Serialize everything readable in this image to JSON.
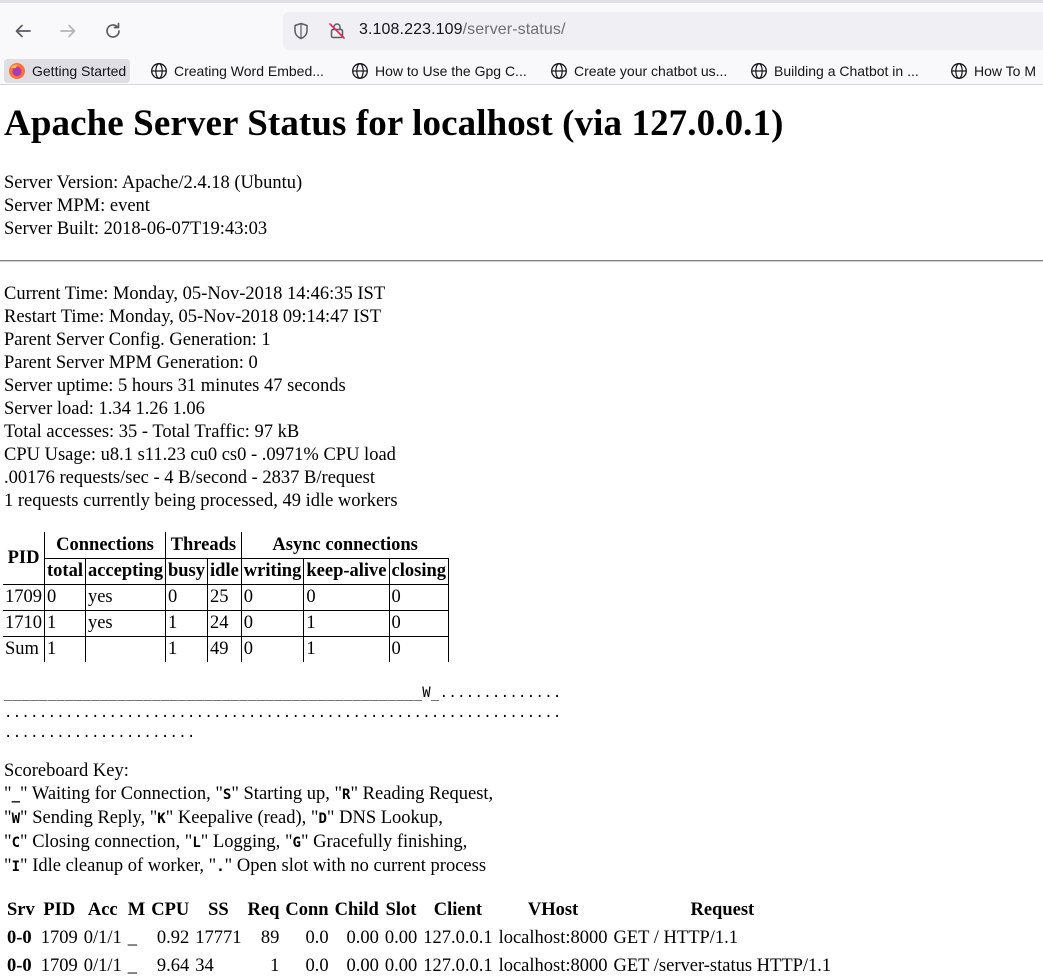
{
  "browser": {
    "url_host": "3.108.223.109",
    "url_path": "/server-status/",
    "bookmarks": [
      {
        "label": "Getting Started"
      },
      {
        "label": "Creating Word Embed..."
      },
      {
        "label": "How to Use the Gpg C..."
      },
      {
        "label": "Create your chatbot us..."
      },
      {
        "label": "Building a Chatbot in ..."
      },
      {
        "label": "How To M"
      }
    ]
  },
  "page": {
    "title": "Apache Server Status for localhost (via 127.0.0.1)",
    "server_info": [
      "Server Version: Apache/2.4.18 (Ubuntu)",
      "Server MPM: event",
      "Server Built: 2018-06-07T19:43:03"
    ],
    "status_info": [
      "Current Time: Monday, 05-Nov-2018 14:46:35 IST",
      "Restart Time: Monday, 05-Nov-2018 09:14:47 IST",
      "Parent Server Config. Generation: 1",
      "Parent Server MPM Generation: 0",
      "Server uptime: 5 hours 31 minutes 47 seconds",
      "Server load: 1.34 1.26 1.06",
      "Total accesses: 35 - Total Traffic: 97 kB",
      "CPU Usage: u8.1 s11.23 cu0 cs0 - .0971% CPU load",
      ".00176 requests/sec - 4 B/second - 2837 B/request",
      "1 requests currently being processed, 49 idle workers"
    ],
    "worker_table": {
      "group_headers": {
        "pid": "PID",
        "connections": "Connections",
        "threads": "Threads",
        "async": "Async connections"
      },
      "sub_headers": [
        "total",
        "accepting",
        "busy",
        "idle",
        "writing",
        "keep-alive",
        "closing"
      ],
      "rows": [
        [
          "1709",
          "0",
          "yes",
          "0",
          "25",
          "0",
          "0",
          "0"
        ],
        [
          "1710",
          "1",
          "yes",
          "1",
          "24",
          "0",
          "1",
          "0"
        ],
        [
          "Sum",
          "1",
          "",
          "1",
          "49",
          "0",
          "1",
          "0"
        ]
      ]
    },
    "scoreboard": [
      "________________________________________________W_..............",
      "................................................................",
      "......................"
    ],
    "scoreboard_key": {
      "heading": "Scoreboard Key:",
      "lines": [
        [
          {
            "code": "_",
            "desc": " Waiting for Connection, "
          },
          {
            "code": "S",
            "desc": " Starting up, "
          },
          {
            "code": "R",
            "desc": " Reading Request,"
          }
        ],
        [
          {
            "code": "W",
            "desc": " Sending Reply, "
          },
          {
            "code": "K",
            "desc": " Keepalive (read), "
          },
          {
            "code": "D",
            "desc": " DNS Lookup,"
          }
        ],
        [
          {
            "code": "C",
            "desc": " Closing connection, "
          },
          {
            "code": "L",
            "desc": " Logging, "
          },
          {
            "code": "G",
            "desc": " Gracefully finishing,"
          }
        ],
        [
          {
            "code": "I",
            "desc": " Idle cleanup of worker, "
          },
          {
            "code": ".",
            "desc": " Open slot with no current process"
          }
        ]
      ]
    },
    "request_table": {
      "headers": [
        "Srv",
        "PID",
        "Acc",
        "M",
        "CPU",
        "SS",
        "Req",
        "Conn",
        "Child",
        "Slot",
        "Client",
        "VHost",
        "Request"
      ],
      "rows": [
        [
          "0-0",
          "1709",
          "0/1/1",
          "_",
          "0.92",
          "17771",
          "89",
          "0.0",
          "0.00",
          "0.00",
          "127.0.0.1",
          "localhost:8000",
          "GET / HTTP/1.1"
        ],
        [
          "0-0",
          "1709",
          "0/1/1",
          "_",
          "9.64",
          "34",
          "1",
          "0.0",
          "0.00",
          "0.00",
          "127.0.0.1",
          "localhost:8000",
          "GET /server-status HTTP/1.1"
        ]
      ]
    }
  }
}
